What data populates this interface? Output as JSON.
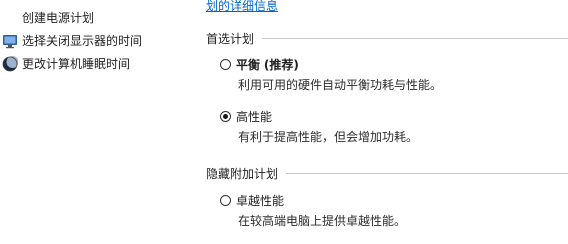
{
  "sidebar": {
    "items": [
      {
        "label": "创建电源计划",
        "icon": "none"
      },
      {
        "label": "选择关闭显示器的时间",
        "icon": "monitor-icon"
      },
      {
        "label": "更改计算机睡眠时间",
        "icon": "moon-icon"
      }
    ]
  },
  "main": {
    "top_link": "划的详细信息",
    "preferred_header": "首选计划",
    "hidden_header": "隐藏附加计划",
    "plans": [
      {
        "name": "平衡",
        "recommended": "(推荐)",
        "description": "利用可用的硬件自动平衡功耗与性能。",
        "selected": false
      },
      {
        "name": "高性能",
        "description": "有利于提高性能，但会增加功耗。",
        "selected": true
      },
      {
        "name": "卓越性能",
        "description": "在较高端电脑上提供卓越性能。",
        "selected": false
      }
    ]
  },
  "colors": {
    "link": "#0066cc",
    "rule": "#c8c8c8",
    "text": "#1e1e1e"
  }
}
